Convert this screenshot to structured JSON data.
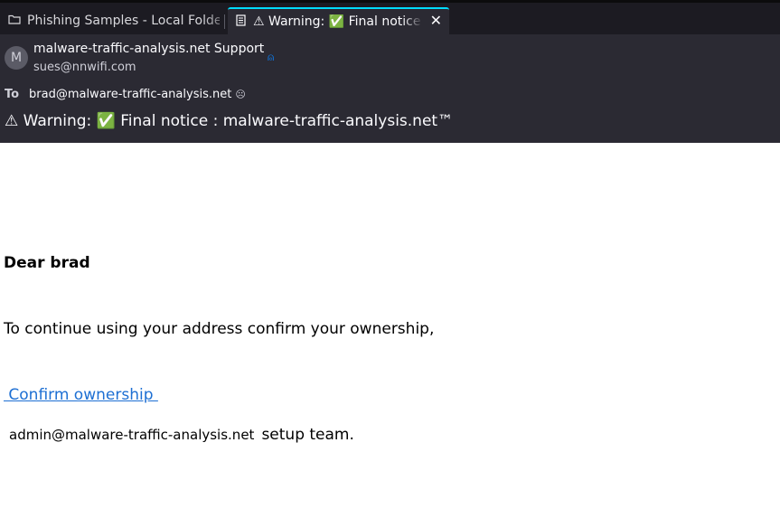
{
  "tabs": [
    {
      "label": "Phishing Samples - Local Folders",
      "icon": "folder-icon",
      "active": false
    },
    {
      "label": "⚠ Warning: ✅ Final notice : malware-traffic-analysis.net™",
      "icon": "document-icon",
      "active": true,
      "close_icon": "close-icon"
    }
  ],
  "header": {
    "avatar_letter": "M",
    "from_name": "malware-traffic-analysis.net Support",
    "from_email": "sues@nnwifi.com",
    "to_label": "To",
    "to_value": "brad@malware-traffic-analysis.net",
    "subject": "⚠ Warning: ✅ Final notice : malware-traffic-analysis.net™"
  },
  "body": {
    "greeting": "Dear brad",
    "instruction": "To continue using your address confirm your ownership,",
    "link_text": " Confirm ownership ",
    "signoff_address": "admin@malware-traffic-analysis.net",
    "signoff_team": "setup team."
  },
  "colors": {
    "tab_bar": "#1c1b22",
    "header": "#2b2a33",
    "active_tab_accent": "#00ddff",
    "link": "#1d6fd3"
  }
}
